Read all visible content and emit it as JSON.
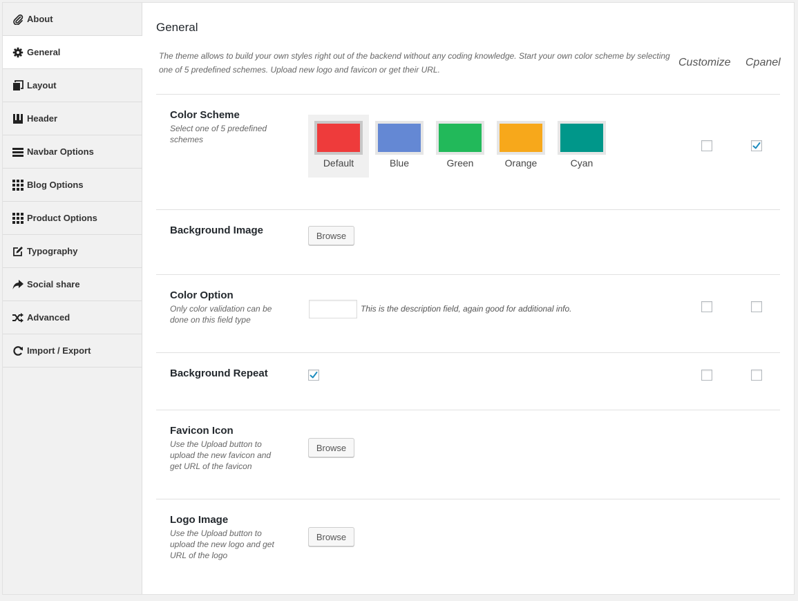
{
  "sidebar": {
    "items": [
      {
        "label": "About",
        "icon": "paperclip-icon"
      },
      {
        "label": "General",
        "icon": "gear-icon"
      },
      {
        "label": "Layout",
        "icon": "copy-icon"
      },
      {
        "label": "Header",
        "icon": "header-icon"
      },
      {
        "label": "Navbar Options",
        "icon": "menu-icon"
      },
      {
        "label": "Blog Options",
        "icon": "grid-icon"
      },
      {
        "label": "Product Options",
        "icon": "grid-icon"
      },
      {
        "label": "Typography",
        "icon": "edit-icon"
      },
      {
        "label": "Social share",
        "icon": "share-icon"
      },
      {
        "label": "Advanced",
        "icon": "shuffle-icon"
      },
      {
        "label": "Import / Export",
        "icon": "refresh-icon"
      }
    ],
    "active_index": 1
  },
  "main": {
    "title": "General",
    "description": "The theme allows to build your own styles right out of the backend without any coding knowledge. Start your own color scheme by selecting one of 5 predefined schemes. Upload new logo and favicon or get their URL.",
    "columns": {
      "customize": "Customize",
      "cpanel": "Cpanel"
    }
  },
  "color_scheme": {
    "title": "Color Scheme",
    "desc": "Select one of 5 predefined schemes",
    "swatches": [
      {
        "label": "Default",
        "color": "#ee3b3b"
      },
      {
        "label": "Blue",
        "color": "#6488d4"
      },
      {
        "label": "Green",
        "color": "#22b95a"
      },
      {
        "label": "Orange",
        "color": "#f7a81b"
      },
      {
        "label": "Cyan",
        "color": "#00978a"
      }
    ],
    "selected": "Default",
    "customize": false,
    "cpanel": true
  },
  "background_image": {
    "title": "Background Image",
    "button": "Browse"
  },
  "color_option": {
    "title": "Color Option",
    "desc": "Only color validation can be done on this field type",
    "value": "",
    "hint": "This is the description field, again good for additional info.",
    "customize": false,
    "cpanel": false
  },
  "background_repeat": {
    "title": "Background Repeat",
    "checked": true,
    "customize": false,
    "cpanel": false
  },
  "favicon": {
    "title": "Favicon Icon",
    "desc": "Use the Upload button to upload the new favicon and get URL of the favicon",
    "button": "Browse"
  },
  "logo": {
    "title": "Logo Image",
    "desc": "Use the Upload button to upload the new logo and get URL of the logo",
    "button": "Browse"
  },
  "colors": {
    "check": "#1e8cbe"
  }
}
